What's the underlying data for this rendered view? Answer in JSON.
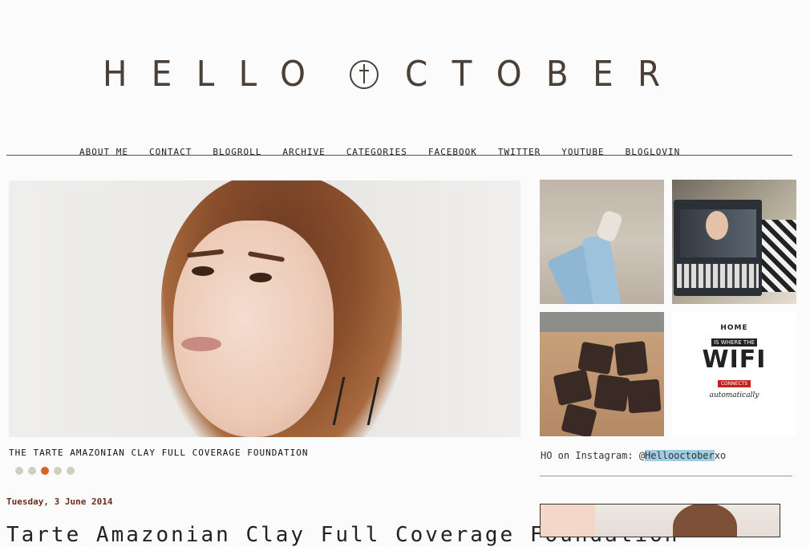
{
  "header": {
    "logo_part1": "HELLO",
    "logo_part2": "CTOBER"
  },
  "nav": {
    "items": [
      "ABOUT ME",
      "CONTACT",
      "BLOGROLL",
      "ARCHIVE",
      "CATEGORIES",
      "FACEBOOK",
      "TWITTER",
      "YOUTUBE",
      "BLOGLOVIN"
    ]
  },
  "slider": {
    "caption": "THE TARTE AMAZONIAN CLAY FULL COVERAGE FOUNDATION",
    "dot_count": 5,
    "active_dot": 3
  },
  "post": {
    "date": "Tuesday, 3 June 2014",
    "title_partial": "Tarte Amazonian Clay Full Coverage Foundation"
  },
  "instagram": {
    "tiles": [
      {
        "icon": "photo-legs-sneakers"
      },
      {
        "icon": "photo-laptop-video"
      },
      {
        "icon": "photo-brownies"
      },
      {
        "icon": "photo-home-wifi-print"
      }
    ],
    "wifi_print": {
      "home": "HOME",
      "where": "IS WHERE THE",
      "wifi": "WIFI",
      "connects": "CONNECTS",
      "auto": "automatically"
    },
    "caption_prefix": "HO on Instagram: @",
    "handle": "Hellooctober",
    "handle_suffix": "xo"
  },
  "colors": {
    "accent": "#d9622a",
    "dot_inactive": "#cfcfbf",
    "date": "#6b2f1a",
    "logo": "#4a4038",
    "handle_highlight": "#9fcde3"
  }
}
